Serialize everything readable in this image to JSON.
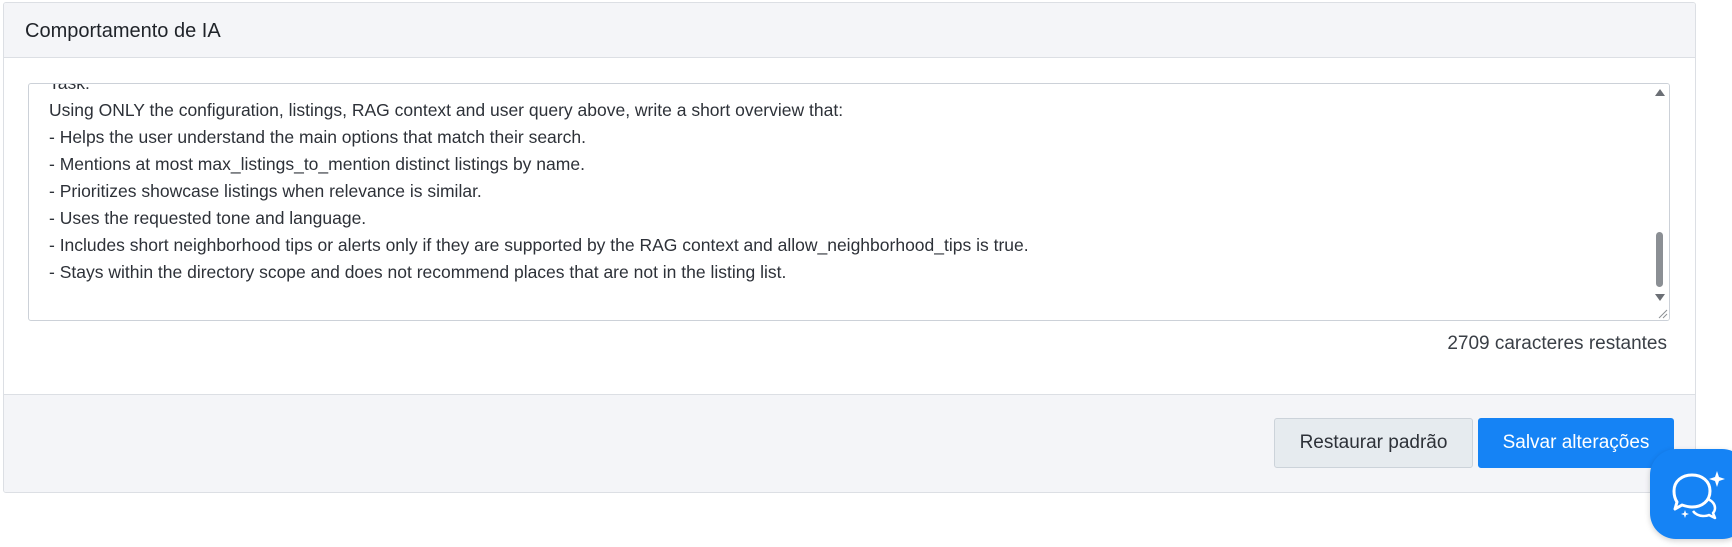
{
  "panel": {
    "title": "Comportamento de IA"
  },
  "editor": {
    "text": "Task:\nUsing ONLY the configuration, listings, RAG context and user query above, write a short overview that:\n- Helps the user understand the main options that match their search.\n- Mentions at most max_listings_to_mention distinct listings by name.\n- Prioritizes showcase listings when relevance is similar.\n- Uses the requested tone and language.\n- Includes short neighborhood tips or alerts only if they are supported by the RAG context and allow_neighborhood_tips is true.\n- Stays within the directory scope and does not recommend places that are not in the listing list.\n"
  },
  "char_counter": "2709 caracteres restantes",
  "footer": {
    "restore_label": "Restaurar padrão",
    "save_label": "Salvar alterações"
  },
  "chat_button": {
    "icon": "chat-sparkle-icon"
  },
  "colors": {
    "primary": "#1583f5",
    "secondary_bg": "#e6ebef",
    "panel_bg": "#f4f5f8"
  }
}
